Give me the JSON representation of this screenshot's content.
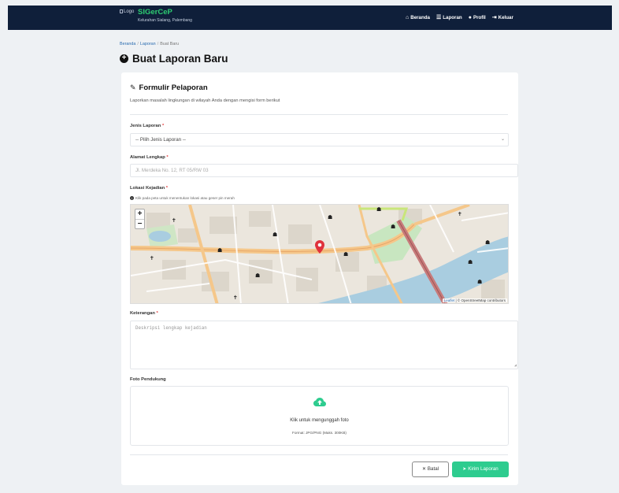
{
  "navbar": {
    "logo_alt": "Logo",
    "brand_name": "SIGerCeP",
    "brand_sub": "Kelurahan Sialang, Palembang",
    "links": [
      {
        "icon": "home-icon",
        "label": "Beranda"
      },
      {
        "icon": "list-icon",
        "label": "Laporan"
      },
      {
        "icon": "user-icon",
        "label": "Profil"
      },
      {
        "icon": "logout-icon",
        "label": "Keluar"
      }
    ]
  },
  "breadcrumb": [
    "Beranda",
    "Laporan",
    "Buat Baru"
  ],
  "page_title": "Buat Laporan Baru",
  "form": {
    "title": "Formulir Pelaporan",
    "description": "Laporkan masalah lingkungan di wilayah Anda dengan mengisi form berikut",
    "jenis_label": "Jenis Laporan",
    "jenis_value": "-- Pilih Jenis Laporan --",
    "alamat_label": "Alamat Lengkap",
    "alamat_placeholder": "Jl. Merdeka No. 12, RT 05/RW 03",
    "lokasi_label": "Lokasi Kejadian",
    "lokasi_hint": "Klik pada peta untuk menentukan lokasi atau geser pin merah",
    "keterangan_label": "Keterangan",
    "keterangan_placeholder": "Deskripsi lengkap kejadian",
    "foto_label": "Foto Pendukung",
    "upload_text": "Klik untuk mengunggah foto",
    "upload_format": "Format: JPG/PNG (Maks. 300KB)",
    "required_mark": "*",
    "cancel_label": "Batal",
    "submit_label": "Kirim Laporan"
  },
  "map": {
    "attribution_leaflet": "Leaflet",
    "attribution_osm": "| © OpenStreetMap contributors",
    "zoom_in": "+",
    "zoom_out": "−",
    "colors": {
      "pin": "#e0323c",
      "river": "#a9cde0",
      "road": "#f5c78a"
    }
  },
  "colors": {
    "navbar": "#0f1f3a",
    "brand": "#2ecc71",
    "submit": "#2ecc8f",
    "required": "#e53e3e"
  }
}
